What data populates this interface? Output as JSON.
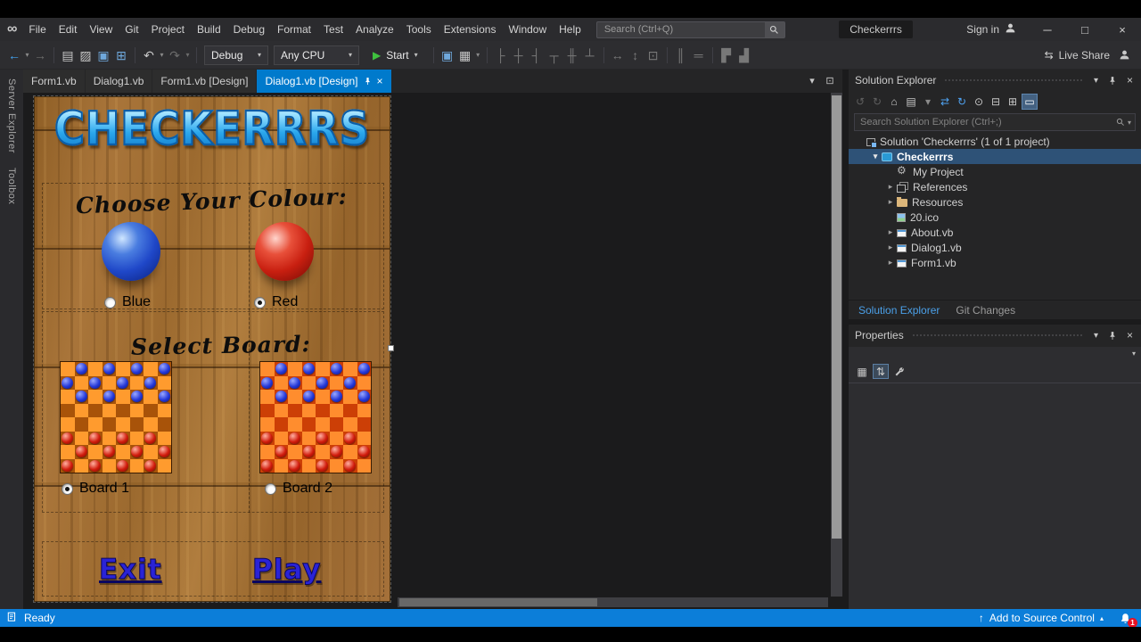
{
  "colors": {
    "accent": "#007acc",
    "status_bar": "#0c7ed9",
    "link_blue": "#2a23d6",
    "wood_base": "#a0713a",
    "logo_blue": "#2aa7ec"
  },
  "titlebar": {
    "menus": [
      "File",
      "Edit",
      "View",
      "Git",
      "Project",
      "Build",
      "Debug",
      "Format",
      "Test",
      "Analyze",
      "Tools",
      "Extensions",
      "Window",
      "Help"
    ],
    "search_placeholder": "Search (Ctrl+Q)",
    "window_title": "Checkerrrs",
    "sign_in_label": "Sign in",
    "window_controls": {
      "minimize": "─",
      "maximize": "□",
      "close": "×"
    }
  },
  "toolbar": {
    "debug_config": "Debug",
    "platform": "Any CPU",
    "start_label": "Start",
    "start_glyph": "▶",
    "live_share_label": "Live Share",
    "live_share_glyph": "⇆",
    "left_icons": [
      {
        "name": "navigate-back-icon",
        "glyph": "←",
        "color": "#42a5f5"
      },
      {
        "name": "navigate-back-caret-icon",
        "glyph": "▾",
        "color": "#8a8a8a",
        "small": true
      },
      {
        "name": "navigate-forward-icon",
        "glyph": "→",
        "color": "#6d6d6d"
      },
      {
        "name": "separator"
      },
      {
        "name": "new-project-icon",
        "glyph": "▤",
        "color": "#c8c8c8"
      },
      {
        "name": "open-file-icon",
        "glyph": "▨",
        "color": "#c8c8c8"
      },
      {
        "name": "save-icon",
        "glyph": "▣",
        "color": "#6fa8dc"
      },
      {
        "name": "save-all-icon",
        "glyph": "⊞",
        "color": "#6fa8dc"
      },
      {
        "name": "separator"
      },
      {
        "name": "undo-icon",
        "glyph": "↶",
        "color": "#c8c8c8"
      },
      {
        "name": "undo-caret-icon",
        "glyph": "▾",
        "color": "#8a8a8a",
        "small": true
      },
      {
        "name": "redo-icon",
        "glyph": "↷",
        "color": "#6d6d6d"
      },
      {
        "name": "redo-caret-icon",
        "glyph": "▾",
        "color": "#6d6d6d",
        "small": true
      },
      {
        "name": "separator"
      }
    ],
    "mid_icons": [
      {
        "name": "separator"
      },
      {
        "name": "snap-lines-icon",
        "glyph": "▣",
        "color": "#6fa8dc"
      },
      {
        "name": "show-grid-icon",
        "glyph": "▦",
        "color": "#c8c8c8"
      },
      {
        "name": "grid-caret-icon",
        "glyph": "▾",
        "color": "#8a8a8a",
        "small": true
      },
      {
        "name": "separator"
      },
      {
        "name": "align-lefts-icon",
        "glyph": "├",
        "color": "#787878"
      },
      {
        "name": "align-centers-icon",
        "glyph": "┼",
        "color": "#787878"
      },
      {
        "name": "align-rights-icon",
        "glyph": "┤",
        "color": "#787878"
      },
      {
        "name": "align-tops-icon",
        "glyph": "┬",
        "color": "#787878"
      },
      {
        "name": "align-middles-icon",
        "glyph": "╫",
        "color": "#787878"
      },
      {
        "name": "align-bottoms-icon",
        "glyph": "┴",
        "color": "#787878"
      },
      {
        "name": "separator"
      },
      {
        "name": "same-width-icon",
        "glyph": "↔",
        "color": "#787878"
      },
      {
        "name": "same-height-icon",
        "glyph": "↕",
        "color": "#787878"
      },
      {
        "name": "same-size-icon",
        "glyph": "⊡",
        "color": "#787878"
      },
      {
        "name": "separator"
      },
      {
        "name": "horizontal-spacing-icon",
        "glyph": "║",
        "color": "#787878"
      },
      {
        "name": "vertical-spacing-icon",
        "glyph": "═",
        "color": "#787878"
      },
      {
        "name": "separator"
      },
      {
        "name": "bring-to-front-icon",
        "glyph": "▛",
        "color": "#787878"
      },
      {
        "name": "send-to-back-icon",
        "glyph": "▟",
        "color": "#787878"
      }
    ]
  },
  "left_rail": {
    "panels": [
      "Server Explorer",
      "Toolbox"
    ]
  },
  "editor": {
    "tabs": [
      {
        "label": "Form1.vb",
        "active": false
      },
      {
        "label": "Dialog1.vb",
        "active": false
      },
      {
        "label": "Form1.vb [Design]",
        "active": false
      },
      {
        "label": "Dialog1.vb [Design]",
        "active": true
      }
    ],
    "close_glyph": "×",
    "tab_right_icons": [
      {
        "name": "active-files-icon",
        "glyph": "▾",
        "color": "#c8c8c8"
      },
      {
        "name": "window-layout-icon",
        "glyph": "⊡",
        "color": "#c8c8c8"
      }
    ]
  },
  "designer": {
    "logo_text": "CHECKERRRS",
    "choose_colour": "Choose Your Colour:",
    "select_board": "Select Board:",
    "color_options": [
      {
        "label": "Blue",
        "checked": false
      },
      {
        "label": "Red",
        "checked": true
      }
    ],
    "board_options": [
      {
        "label": "Board 1",
        "checked": true
      },
      {
        "label": "Board 2",
        "checked": false
      }
    ],
    "exit_label": "Exit",
    "play_label": "Play",
    "board_rows": 8,
    "board_cols": 8,
    "piece_rows": 3,
    "boards": [
      {
        "light": "#ff9b2e",
        "dark": "#a85309",
        "piece_top": "#2438d8",
        "piece_bottom": "#d11c0c"
      },
      {
        "light": "#ff8d2e",
        "dark": "#cc3f06",
        "piece_top": "#2438d8",
        "piece_bottom": "#d11c0c"
      }
    ]
  },
  "solution_explorer": {
    "title": "Solution Explorer",
    "search_placeholder": "Search Solution Explorer (Ctrl+;)",
    "toolbar_icons": [
      {
        "name": "history-back-icon",
        "glyph": "↺",
        "color": "#5f5f5f"
      },
      {
        "name": "history-forward-icon",
        "glyph": "↻",
        "color": "#5f5f5f"
      },
      {
        "name": "home-icon",
        "glyph": "⌂",
        "color": "#c8c8c8"
      },
      {
        "name": "switch-views-icon",
        "glyph": "▤",
        "color": "#c8c8c8"
      },
      {
        "name": "switch-views-caret-icon",
        "glyph": "▾",
        "color": "#8a8a8a",
        "small": true
      },
      {
        "name": "sync-with-active-document-icon",
        "glyph": "⇄",
        "color": "#4fa3f2"
      },
      {
        "name": "refresh-icon",
        "glyph": "↻",
        "color": "#4fa3f2"
      },
      {
        "name": "nesting-icon",
        "glyph": "⊙",
        "color": "#c8c8c8"
      },
      {
        "name": "collapse-all-icon",
        "glyph": "⊟",
        "color": "#c8c8c8"
      },
      {
        "name": "show-all-files-icon",
        "glyph": "⊞",
        "color": "#c8c8c8"
      },
      {
        "name": "preview-selected-items-icon",
        "glyph": "▭",
        "color": "#ffffff",
        "active": true
      }
    ],
    "tree": [
      {
        "label": "Solution 'Checkerrrs' (1 of 1 project)",
        "icon": "solution",
        "level": 0,
        "arrow": "none",
        "selected": false
      },
      {
        "label": "Checkerrrs",
        "icon": "vbproj",
        "level": 1,
        "arrow": "expanded",
        "selected": true
      },
      {
        "label": "My Project",
        "icon": "gear",
        "level": 2,
        "arrow": "none",
        "selected": false
      },
      {
        "label": "References",
        "icon": "refs",
        "level": 2,
        "arrow": "collapsed",
        "selected": false
      },
      {
        "label": "Resources",
        "icon": "folder",
        "level": 2,
        "arrow": "collapsed",
        "selected": false
      },
      {
        "label": "20.ico",
        "icon": "imgfile",
        "level": 2,
        "arrow": "none",
        "selected": false
      },
      {
        "label": "About.vb",
        "icon": "formfile",
        "level": 2,
        "arrow": "collapsed",
        "selected": false
      },
      {
        "label": "Dialog1.vb",
        "icon": "formfile",
        "level": 2,
        "arrow": "collapsed",
        "selected": false
      },
      {
        "label": "Form1.vb",
        "icon": "formfile",
        "level": 2,
        "arrow": "collapsed",
        "selected": false
      }
    ],
    "bottom_tabs": [
      {
        "label": "Solution Explorer",
        "active": true
      },
      {
        "label": "Git Changes",
        "active": false
      }
    ]
  },
  "properties_panel": {
    "title": "Properties",
    "categorized_glyph": "▦",
    "alphabetical_glyph": "⇅"
  },
  "panel_controls": {
    "chevron": "▾",
    "close": "×"
  },
  "statusbar": {
    "ready": "Ready",
    "up_glyph": "↑",
    "add_scc": "Add to Source Control",
    "caret_glyph": "▴",
    "badge": "1"
  }
}
